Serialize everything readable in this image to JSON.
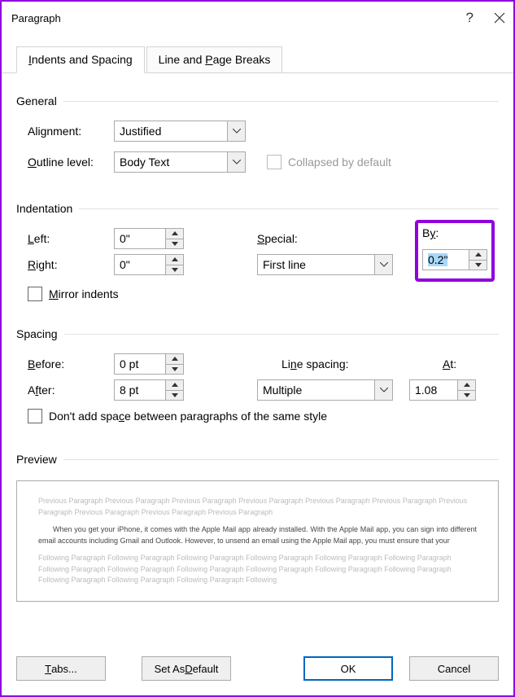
{
  "titlebar": {
    "title": "Paragraph"
  },
  "tabs": {
    "indents": "Indents and Spacing",
    "breaks": "Line and Page Breaks"
  },
  "general": {
    "title": "General",
    "alignment_label": "Alignment:",
    "alignment_value": "Justified",
    "outline_label": "Outline level:",
    "outline_value": "Body Text",
    "collapsed_label": "Collapsed by default"
  },
  "indentation": {
    "title": "Indentation",
    "left_label": "Left:",
    "left_value": "0\"",
    "right_label": "Right:",
    "right_value": "0\"",
    "special_label": "Special:",
    "special_value": "First line",
    "by_label": "By:",
    "by_value": "0.2\"",
    "mirror_label": "Mirror indents"
  },
  "spacing": {
    "title": "Spacing",
    "before_label": "Before:",
    "before_value": "0 pt",
    "after_label": "After:",
    "after_value": "8 pt",
    "line_label": "Line spacing:",
    "line_value": "Multiple",
    "at_label": "At:",
    "at_value": "1.08",
    "dont_add_label": "Don't add space between paragraphs of the same style"
  },
  "preview": {
    "title": "Preview",
    "prev_text": "Previous Paragraph Previous Paragraph Previous Paragraph Previous Paragraph Previous Paragraph Previous Paragraph Previous Paragraph Previous Paragraph Previous Paragraph Previous Paragraph",
    "sample_text": "When you get your iPhone, it comes with the Apple Mail app already installed. With the Apple Mail app, you can sign into different email accounts including Gmail and Outlook. However, to unsend an email using the Apple Mail app, you must ensure that your",
    "next_text": "Following Paragraph Following Paragraph Following Paragraph Following Paragraph Following Paragraph Following Paragraph Following Paragraph Following Paragraph Following Paragraph Following Paragraph Following Paragraph Following Paragraph Following Paragraph Following Paragraph Following Paragraph Following"
  },
  "footer": {
    "tabs": "Tabs...",
    "default": "Set As Default",
    "ok": "OK",
    "cancel": "Cancel"
  }
}
